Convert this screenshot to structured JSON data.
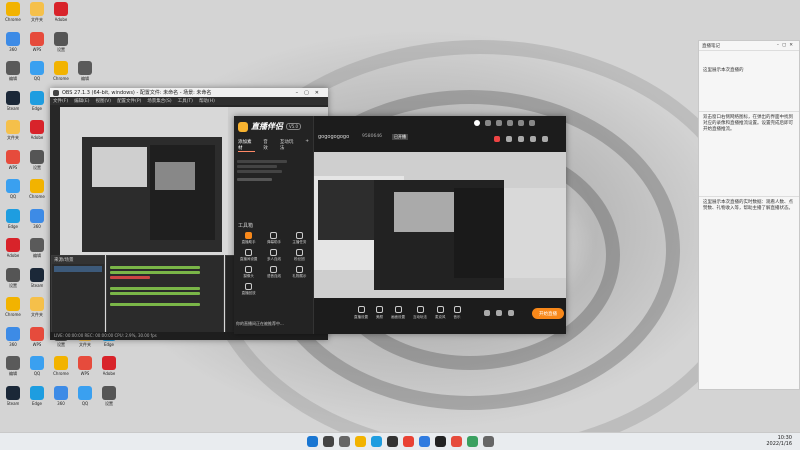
{
  "desktop": {
    "icons": [
      {
        "label": "Chrome",
        "color": "#f2b300"
      },
      {
        "label": "360",
        "color": "#3d8be6"
      },
      {
        "label": "编辑",
        "color": "#5a5a5a"
      },
      {
        "label": "Steam",
        "color": "#1b2838"
      },
      {
        "label": "文件夹",
        "color": "#f5c04a"
      },
      {
        "label": "WPS",
        "color": "#e64b3c"
      },
      {
        "label": "QQ",
        "color": "#3aa0f0"
      },
      {
        "label": "Edge",
        "color": "#1e9de0"
      },
      {
        "label": "Adobe",
        "color": "#d8232a"
      },
      {
        "label": "设置",
        "color": "#555555"
      }
    ]
  },
  "obs_window": {
    "title": "OBS 27.1.3 (64-bit, windows) - 配置文件: 未命名 - 场景: 未命名",
    "menu": [
      "文件(F)",
      "编辑(E)",
      "视图(V)",
      "配置文件(P)",
      "场景集合(S)",
      "工具(T)",
      "帮助(H)"
    ],
    "scenes_title": "来源/场景",
    "status": "LIVE: 00:00:00  REC: 00:00:00  CPU: 2.9%, 30.00 fps"
  },
  "streamer_app": {
    "logo": "直播伴侣",
    "badge": "V5.0",
    "tabs": [
      "添加素材",
      "音效",
      "互动玩法"
    ],
    "room_name": "gogogogogo",
    "room_id": "9580646",
    "room_tag": "已开播",
    "tool_title": "工具箱",
    "tools": [
      "直播助手",
      "弹幕助手",
      "主播任务",
      "直播间设置",
      "多人连线",
      "粉丝团",
      "摄像头",
      "语音连线",
      "礼物展示",
      "直播回放"
    ],
    "bottom_tip": "你的直播间正在被推荐中...",
    "bottom_tools": [
      "直播设置",
      "美颜",
      "画面设置",
      "互动玩法",
      "麦克风",
      "音乐"
    ],
    "start_label": "开始直播"
  },
  "notes": {
    "title": "直播笔记",
    "p1": "这里展示本次直播的",
    "p2": "双击窗口右侧网络图标，在弹出的界面中找到对应的录像和直播推流设置。设置完成后即可开始直播推流。",
    "p3": "这里展示本次直播的实时数据：观看人数、点赞数、礼物收入等，帮助主播了解直播状态。"
  },
  "taskbar": {
    "time": "10:30",
    "date": "2022/1/16",
    "icons": [
      {
        "name": "windows-start-icon",
        "color": "#1976d2"
      },
      {
        "name": "search-icon",
        "color": "#444444"
      },
      {
        "name": "task-view-icon",
        "color": "#666666"
      },
      {
        "name": "file-explorer-icon",
        "color": "#f2b300"
      },
      {
        "name": "edge-icon",
        "color": "#1e9de0"
      },
      {
        "name": "obs-icon",
        "color": "#333333"
      },
      {
        "name": "chrome-icon",
        "color": "#e94235"
      },
      {
        "name": "store-icon",
        "color": "#2f7be0"
      },
      {
        "name": "app-icon",
        "color": "#222222"
      },
      {
        "name": "app2-icon",
        "color": "#e64b3c"
      },
      {
        "name": "app3-icon",
        "color": "#3aa060"
      },
      {
        "name": "app4-icon",
        "color": "#666666"
      }
    ]
  }
}
